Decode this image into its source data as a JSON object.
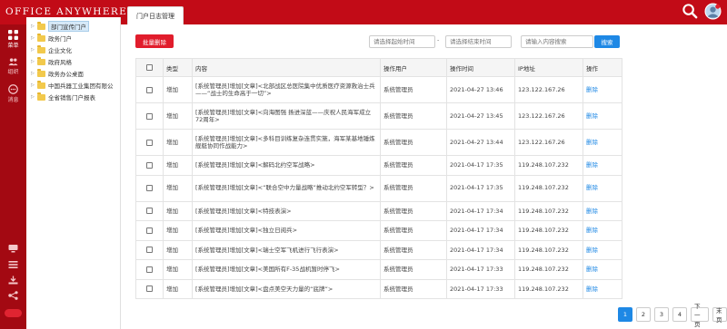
{
  "app": {
    "logo_text": "Office Anywhere",
    "logo_mark": "®",
    "colors": {
      "brand": "#c20b17",
      "nav_dark": "#a30912",
      "accent": "#1e88e5",
      "danger": "#e11d2c"
    }
  },
  "topbar": {
    "search_icon": "search-icon",
    "avatar": "user-avatar"
  },
  "leftnav": {
    "items": [
      {
        "label": "菜单",
        "icon": "grid-icon"
      },
      {
        "label": "组织",
        "icon": "users-icon"
      },
      {
        "label": "消息",
        "icon": "message-icon"
      }
    ]
  },
  "tree": {
    "items": [
      {
        "label": "部门宣传门户",
        "selected": true
      },
      {
        "label": "政务门户"
      },
      {
        "label": "企业文化"
      },
      {
        "label": "政府风格"
      },
      {
        "label": "政务办公桌面"
      },
      {
        "label": "中国兵器工业集团有限公"
      },
      {
        "label": "全省销售门户报表"
      }
    ]
  },
  "tabs": [
    {
      "label": "门户日志管理"
    }
  ],
  "toolbar": {
    "batch_delete": "批量删除",
    "start_time_placeholder": "请选择起始时间",
    "dash": "-",
    "end_time_placeholder": "请选择结束时间",
    "keyword_placeholder": "请输入内容搜索",
    "search": "搜索"
  },
  "table": {
    "headers": [
      "",
      "类型",
      "内容",
      "操作用户",
      "操作时间",
      "IP地址",
      "操作"
    ],
    "rows": [
      {
        "type": "增加",
        "content": "[系统管理员]增加[文章]<北部战区总医院集中优质医疗资源救治士兵——“战士的生命高于一切”>",
        "user": "系统管理员",
        "time": "2021-04-27 13:46",
        "ip": "123.122.167.26",
        "action": "删除"
      },
      {
        "type": "增加",
        "content": "[系统管理员]增加[文章]<向海图强 扬进深蓝——庆祝人民海军成立72周年>",
        "user": "系统管理员",
        "time": "2021-04-27 13:45",
        "ip": "123.122.167.26",
        "action": "删除"
      },
      {
        "type": "增加",
        "content": "[系统管理员]增加[文章]<多科目训练复杂连贯实施，海军某基地锤炼舰艇协同作战能力>",
        "user": "系统管理员",
        "time": "2021-04-27 13:44",
        "ip": "123.122.167.26",
        "action": "删除"
      },
      {
        "type": "增加",
        "content": "[系统管理员]增加[文章]<解码北约空军战略>",
        "user": "系统管理员",
        "time": "2021-04-17 17:35",
        "ip": "119.248.107.232",
        "action": "删除"
      },
      {
        "type": "增加",
        "content": "[系统管理员]增加[文章]<“联合空中力量战略”推动北约空军转型？>",
        "user": "系统管理员",
        "time": "2021-04-17 17:35",
        "ip": "119.248.107.232",
        "action": "删除"
      },
      {
        "type": "增加",
        "content": "[系统管理员]增加[文章]<特技表演>",
        "user": "系统管理员",
        "time": "2021-04-17 17:34",
        "ip": "119.248.107.232",
        "action": "删除"
      },
      {
        "type": "增加",
        "content": "[系统管理员]增加[文章]<独立日阅兵>",
        "user": "系统管理员",
        "time": "2021-04-17 17:34",
        "ip": "119.248.107.232",
        "action": "删除"
      },
      {
        "type": "增加",
        "content": "[系统管理员]增加[文章]<瑞士空军飞机进行飞行表演>",
        "user": "系统管理员",
        "time": "2021-04-17 17:34",
        "ip": "119.248.107.232",
        "action": "删除"
      },
      {
        "type": "增加",
        "content": "[系统管理员]增加[文章]<美国所有F-35战机暂时停飞>",
        "user": "系统管理员",
        "time": "2021-04-17 17:33",
        "ip": "119.248.107.232",
        "action": "删除"
      },
      {
        "type": "增加",
        "content": "[系统管理员]增加[文章]<盘点美空天力量的“底牌”>",
        "user": "系统管理员",
        "time": "2021-04-17 17:33",
        "ip": "119.248.107.232",
        "action": "删除"
      }
    ]
  },
  "pager": {
    "pages": [
      "1",
      "2",
      "3",
      "4"
    ],
    "current": "1",
    "next": "下一页",
    "last": "末页"
  }
}
